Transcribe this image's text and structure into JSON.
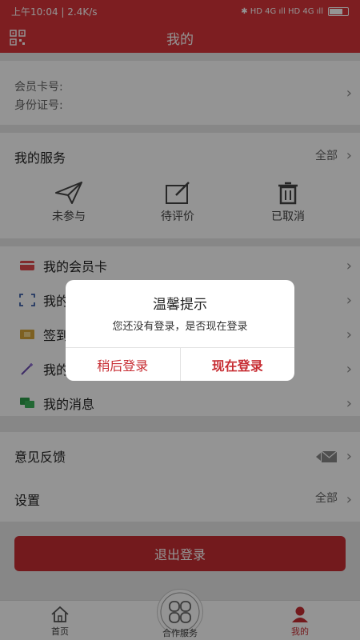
{
  "status": {
    "left": "上午10:04 | 2.4K/s",
    "right": "✱ HD 4G ıll HD 4G ıll",
    "battery": "69"
  },
  "header": {
    "title": "我的"
  },
  "member": {
    "card_label": "会员卡号:",
    "id_label": "身份证号:"
  },
  "services": {
    "title": "我的服务",
    "all": "全部",
    "items": [
      {
        "label": "未参与",
        "icon": "paper-plane-icon"
      },
      {
        "label": "待评价",
        "icon": "edit-icon"
      },
      {
        "label": "已取消",
        "icon": "trash-icon"
      }
    ]
  },
  "menu": {
    "items": [
      {
        "label": "我的会员卡",
        "icon": "card-icon"
      },
      {
        "label": "我的",
        "icon": "scan-icon"
      },
      {
        "label": "签到",
        "icon": "ticket-icon"
      },
      {
        "label": "我的",
        "icon": "magic-wand-icon"
      },
      {
        "label": "我的消息",
        "icon": "chat-icon"
      }
    ]
  },
  "settings": {
    "feedback": "意见反馈",
    "settings": "设置",
    "all": "全部"
  },
  "logout": {
    "label": "退出登录"
  },
  "tabs": {
    "home": "首页",
    "coop": "合作服务",
    "mine": "我的"
  },
  "dialog": {
    "title": "温馨提示",
    "message": "您还没有登录，是否现在登录",
    "later": "稍后登录",
    "now": "现在登录"
  },
  "colors": {
    "brand": "#d7353a",
    "button": "#c72d33",
    "active_tab": "#c72d33"
  }
}
